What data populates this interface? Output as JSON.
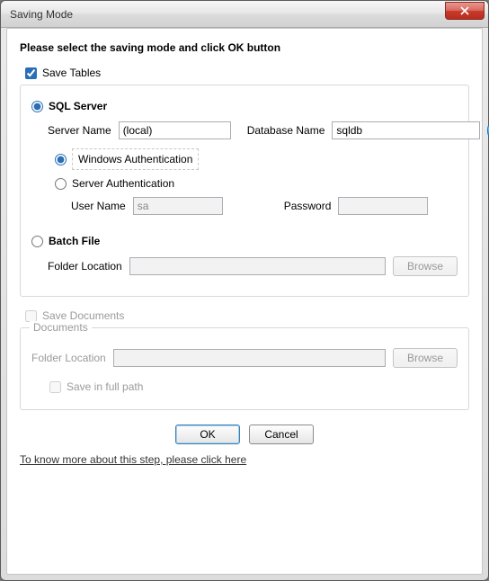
{
  "window": {
    "title": "Saving Mode"
  },
  "heading": "Please select the saving mode and click OK button",
  "save_tables": {
    "label": "Save Tables"
  },
  "sql": {
    "label": "SQL Server",
    "server_name_label": "Server Name",
    "server_name_value": "(local)",
    "database_name_label": "Database Name",
    "database_name_value": "sqldb",
    "auth": {
      "windows_label": "Windows Authentication",
      "server_label": "Server Authentication",
      "user_name_label": "User Name",
      "user_name_value": "sa",
      "password_label": "Password"
    }
  },
  "batch": {
    "label": "Batch File",
    "folder_location_label": "Folder Location",
    "browse_label": "Browse"
  },
  "save_documents": {
    "label": "Save Documents"
  },
  "documents": {
    "legend": "Documents",
    "folder_location_label": "Folder Location",
    "browse_label": "Browse",
    "save_full_path_label": "Save in full path"
  },
  "buttons": {
    "ok": "OK",
    "cancel": "Cancel"
  },
  "footer_link": "To know more about this step, please click here"
}
